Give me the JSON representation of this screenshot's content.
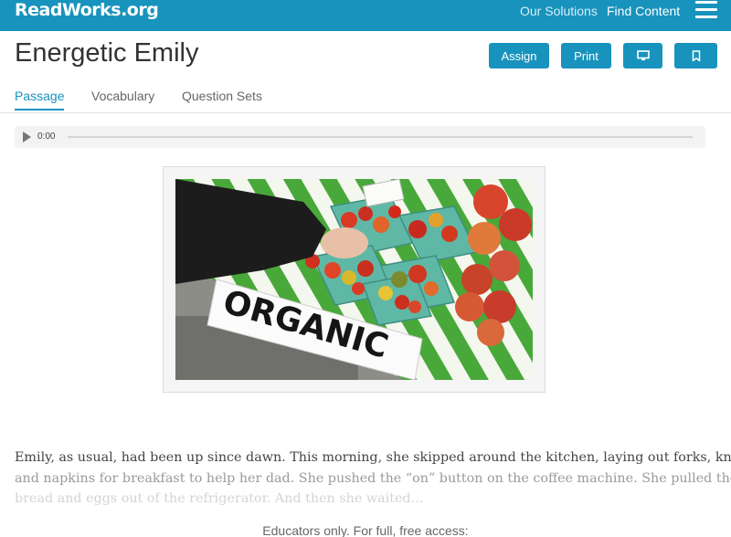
{
  "header": {
    "logo": "ReadWorks.org",
    "nav": [
      "Our Solutions",
      "Find Content"
    ],
    "menu_icon": "hamburger-icon"
  },
  "article": {
    "title": "Energetic Emily",
    "buttons": {
      "assign": "Assign",
      "print": "Print",
      "present_icon": "monitor-icon",
      "save_icon": "bookmark-icon"
    },
    "tabs": [
      "Passage",
      "Vocabulary",
      "Question Sets"
    ],
    "active_tab": "Passage"
  },
  "audio": {
    "time": "0:00",
    "icon": "play-icon"
  },
  "image": {
    "sign_text": "ORGANIC"
  },
  "passage": {
    "lines": [
      "Emily, as usual, had been up since dawn. This morning, she skipped around the kitchen, laying out forks, knives",
      "and napkins for breakfast to help her dad. She pushed the “on” button on the coffee machine. She pulled the",
      "bread and eggs out of the refrigerator. And then she waited…"
    ],
    "access_note": "Educators only. For full, free access:"
  },
  "colors": {
    "brand": "#1893bd",
    "tab_active": "#1893bd"
  }
}
